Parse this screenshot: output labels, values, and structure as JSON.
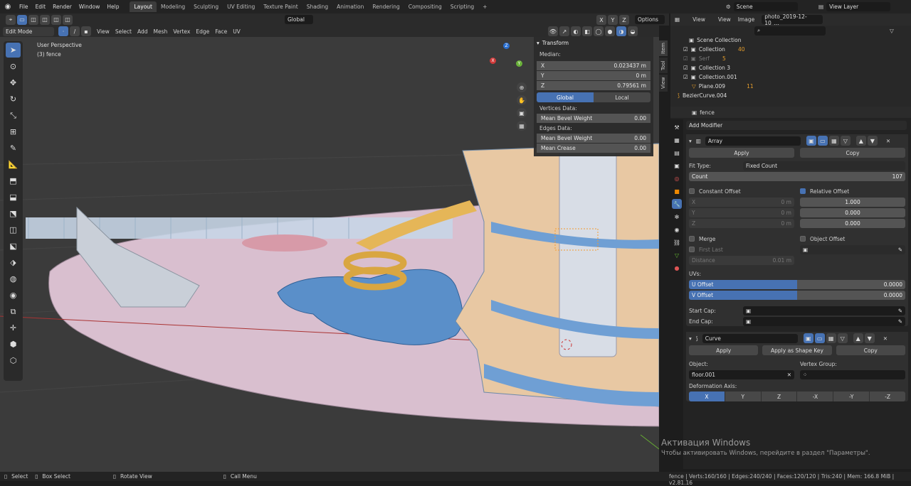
{
  "topbar": {
    "menus": [
      "File",
      "Edit",
      "Render",
      "Window",
      "Help"
    ],
    "workspaces": [
      "Layout",
      "Modeling",
      "Sculpting",
      "UV Editing",
      "Texture Paint",
      "Shading",
      "Animation",
      "Rendering",
      "Compositing",
      "Scripting"
    ],
    "active_workspace": "Layout",
    "plus": "+",
    "scene": "Scene",
    "view_layer": "View Layer"
  },
  "viewport_header": {
    "mode": "Edit Mode",
    "menus": [
      "View",
      "Select",
      "Add",
      "Mesh",
      "Vertex",
      "Edge",
      "Face",
      "UV"
    ],
    "transform_orientation": "Global",
    "axes": [
      "X",
      "Y",
      "Z"
    ],
    "options": "Options"
  },
  "viewport": {
    "perspective": "User Perspective",
    "object_label": "(3) fence",
    "gizmo": {
      "x": "X",
      "y": "Y",
      "z": "Z"
    }
  },
  "side_tabs": [
    "Item",
    "Tool",
    "View"
  ],
  "npanel": {
    "title": "Transform",
    "median": "Median:",
    "x_label": "X",
    "x_value": "0.023437 m",
    "y_label": "Y",
    "y_value": "0 m",
    "z_label": "Z",
    "z_value": "0.79561 m",
    "global": "Global",
    "local": "Local",
    "vertices_data": "Vertices Data:",
    "v_bevel_label": "Mean Bevel Weight",
    "v_bevel_value": "0.00",
    "edges_data": "Edges Data:",
    "e_bevel_label": "Mean Bevel Weight",
    "e_bevel_value": "0.00",
    "crease_label": "Mean Crease",
    "crease_value": "0.00"
  },
  "outliner": {
    "view": "View",
    "display_view": "View",
    "image": "Image",
    "image_name": "photo_2019-12-10_...",
    "rows": [
      {
        "name": "Scene Collection",
        "badge": ""
      },
      {
        "name": "Collection",
        "badge": "40"
      },
      {
        "name": "Serf",
        "badge": "5"
      },
      {
        "name": "Collection 3",
        "badge": ""
      },
      {
        "name": "Collection.001",
        "badge": ""
      },
      {
        "name": "Plane.009",
        "badge": "11"
      },
      {
        "name": "BezierCurve.004",
        "badge": ""
      }
    ]
  },
  "properties": {
    "object_name": "fence",
    "add_modifier": "Add Modifier",
    "array": {
      "name": "Array",
      "apply": "Apply",
      "copy": "Copy",
      "fit_type_label": "Fit Type:",
      "fit_type": "Fixed Count",
      "count_label": "Count",
      "count": "107",
      "constant_offset": "Constant Offset",
      "relative_offset": "Relative Offset",
      "co_x_label": "X",
      "co_x": "0 m",
      "co_y_label": "Y",
      "co_y": "0 m",
      "co_z_label": "Z",
      "co_z": "0 m",
      "ro_x": "1.000",
      "ro_y": "0.000",
      "ro_z": "0.000",
      "merge": "Merge",
      "object_offset": "Object Offset",
      "first_last": "First Last",
      "distance_label": "Distance",
      "distance": "0.01 m",
      "uvs": "UVs:",
      "u_offset_label": "U Offset",
      "u_offset": "0.0000",
      "v_offset_label": "V Offset",
      "v_offset": "0.0000",
      "start_cap": "Start Cap:",
      "end_cap": "End Cap:"
    },
    "curve": {
      "name": "Curve",
      "apply": "Apply",
      "apply_shape": "Apply as Shape Key",
      "copy": "Copy",
      "object_label": "Object:",
      "object": "floor.001",
      "vertex_group_label": "Vertex Group:",
      "deformation_axis": "Deformation Axis:",
      "axes": [
        "X",
        "Y",
        "Z",
        "-X",
        "-Y",
        "-Z"
      ]
    }
  },
  "status": {
    "select": "Select",
    "box_select": "Box Select",
    "rotate_view": "Rotate View",
    "call_menu": "Call Menu",
    "stats": "fence | Verts:160/160 | Edges:240/240 | Faces:120/120 | Tris:240 | Mem: 166.8 MiB | v2.81.16"
  },
  "watermark": {
    "title": "Активация Windows",
    "subtitle": "Чтобы активировать Windows, перейдите в раздел \"Параметры\"."
  }
}
